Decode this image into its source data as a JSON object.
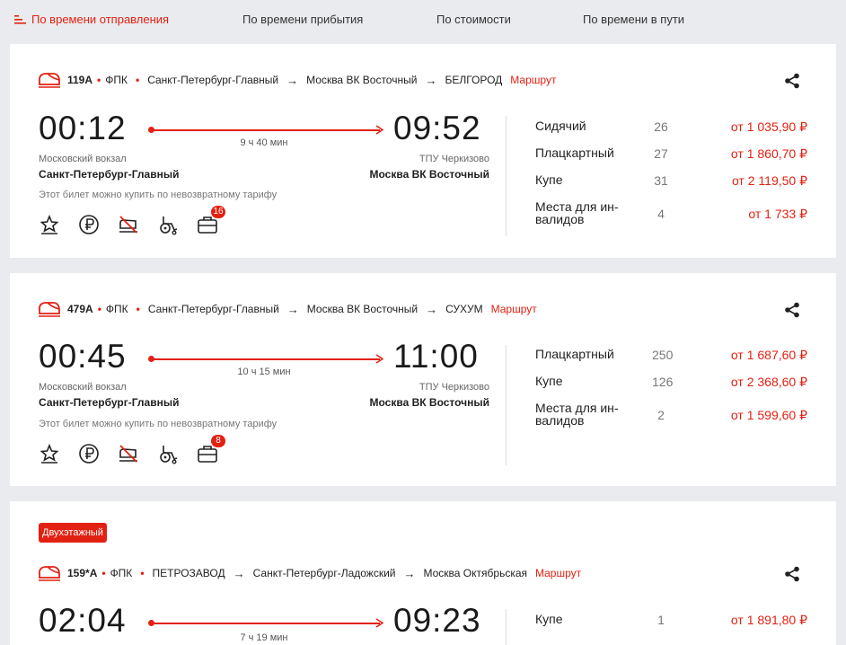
{
  "sort": {
    "departure": "По времени отправления",
    "arrival": "По времени прибытия",
    "price": "По стоимости",
    "duration": "По времени в пути"
  },
  "route_link_label": "Маршрут",
  "trains": [
    {
      "number": "119А",
      "carrier": "ФПК",
      "route": [
        "Санкт-Петербург-Главный",
        "Москва ВК Восточный",
        "БЕЛГОРОД"
      ],
      "dep_time": "00:12",
      "arr_time": "09:52",
      "duration": "9 ч 40 мин",
      "dep_station_small": "Московский вокзал",
      "dep_station": "Санкт-Петербург-Главный",
      "arr_station_small": "ТПУ Черкизово",
      "arr_station": "Москва ВК Восточный",
      "note": "Этот билет можно купить по невозвратному тарифу",
      "badge": "16",
      "fares": [
        {
          "name": "Сидячий",
          "seats": "26",
          "price": "от 1 035,90 ₽"
        },
        {
          "name": "Плацкартный",
          "seats": "27",
          "price": "от 1 860,70 ₽"
        },
        {
          "name": "Купе",
          "seats": "31",
          "price": "от 2 119,50 ₽"
        },
        {
          "name": "Места для ин-\nвалидов",
          "seats": "4",
          "price": "от 1 733 ₽"
        }
      ]
    },
    {
      "number": "479А",
      "carrier": "ФПК",
      "route": [
        "Санкт-Петербург-Главный",
        "Москва ВК Восточный",
        "СУХУМ"
      ],
      "dep_time": "00:45",
      "arr_time": "11:00",
      "duration": "10 ч 15 мин",
      "dep_station_small": "Московский вокзал",
      "dep_station": "Санкт-Петербург-Главный",
      "arr_station_small": "ТПУ Черкизово",
      "arr_station": "Москва ВК Восточный",
      "note": "Этот билет можно купить по невозвратному тарифу",
      "badge": "8",
      "fares": [
        {
          "name": "Плацкартный",
          "seats": "250",
          "price": "от 1 687,60 ₽"
        },
        {
          "name": "Купе",
          "seats": "126",
          "price": "от 2 368,60 ₽"
        },
        {
          "name": "Места для ин-\nвалидов",
          "seats": "2",
          "price": "от 1 599,60 ₽"
        }
      ]
    },
    {
      "tag": "Двухэтажный",
      "number": "159*А",
      "carrier": "ФПК",
      "route": [
        "ПЕТРОЗАВОД",
        "Санкт-Петербург-Ладожский",
        "Москва Октябрьская"
      ],
      "dep_time": "02:04",
      "arr_time": "09:23",
      "duration": "7 ч 19 мин",
      "fares": [
        {
          "name": "Купе",
          "seats": "1",
          "price": "от 1 891,80 ₽"
        }
      ]
    }
  ],
  "colors": {
    "accent": "#e32112",
    "background": "#e9ebee",
    "card": "#ffffff"
  }
}
